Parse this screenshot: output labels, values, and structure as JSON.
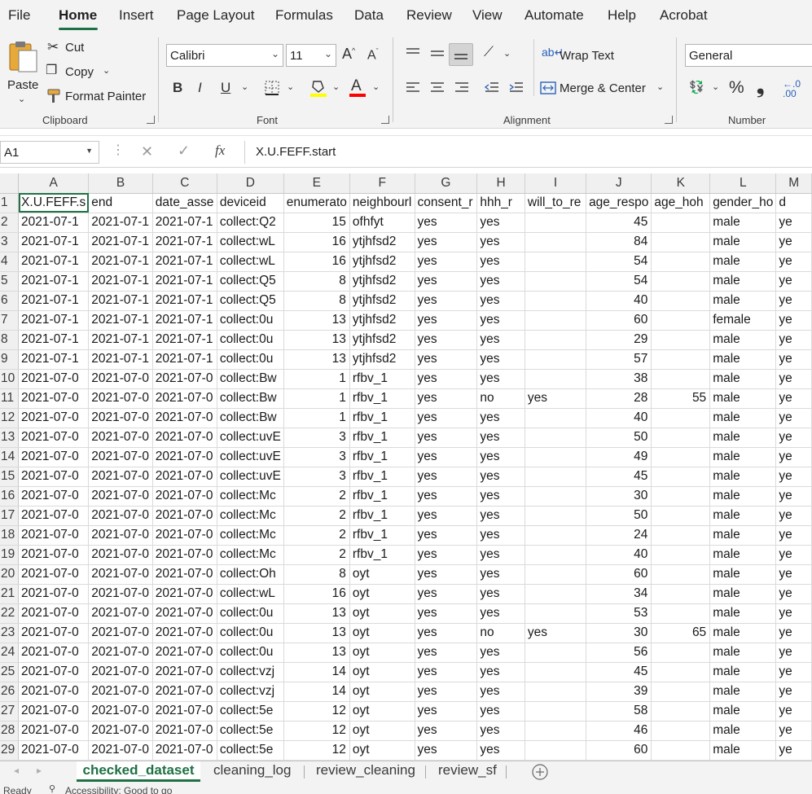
{
  "menu": {
    "tabs": [
      {
        "label": "File"
      },
      {
        "label": "Home"
      },
      {
        "label": "Insert"
      },
      {
        "label": "Page Layout"
      },
      {
        "label": "Formulas"
      },
      {
        "label": "Data"
      },
      {
        "label": "Review"
      },
      {
        "label": "View"
      },
      {
        "label": "Automate"
      },
      {
        "label": "Help"
      },
      {
        "label": "Acrobat"
      }
    ],
    "active": "Home"
  },
  "ribbon": {
    "clipboard": {
      "paste": "Paste",
      "cut": "Cut",
      "copy": "Copy",
      "format_painter": "Format Painter",
      "group": "Clipboard"
    },
    "font": {
      "name": "Calibri",
      "size": "11",
      "group": "Font",
      "highlight_color": "#ffff00",
      "font_color": "#ff0000"
    },
    "alignment": {
      "wrap_text": "Wrap Text",
      "merge_center": "Merge & Center",
      "group": "Alignment"
    },
    "number": {
      "format": "General",
      "group": "Number"
    }
  },
  "formula_bar": {
    "cell_ref": "A1",
    "fx": "fx",
    "content": "X.U.FEFF.start"
  },
  "grid": {
    "columns": [
      "A",
      "B",
      "C",
      "D",
      "E",
      "F",
      "G",
      "H",
      "I",
      "J",
      "K",
      "L",
      "M"
    ],
    "header_row": [
      "X.U.FEFF.s",
      "end",
      "date_asse",
      "deviceid",
      "enumerato",
      "neighbourl",
      "consent_r",
      "hhh_r",
      "will_to_re",
      "age_respo",
      "age_hoh",
      "gender_ho",
      "d"
    ],
    "rows": [
      [
        "2021-07-1",
        "2021-07-1",
        "2021-07-1",
        "collect:Q2",
        "15",
        "ofhfyt",
        "yes",
        "yes",
        "",
        "45",
        "",
        "male",
        "ye"
      ],
      [
        "2021-07-1",
        "2021-07-1",
        "2021-07-1",
        "collect:wL",
        "16",
        "ytjhfsd2",
        "yes",
        "yes",
        "",
        "84",
        "",
        "male",
        "ye"
      ],
      [
        "2021-07-1",
        "2021-07-1",
        "2021-07-1",
        "collect:wL",
        "16",
        "ytjhfsd2",
        "yes",
        "yes",
        "",
        "54",
        "",
        "male",
        "ye"
      ],
      [
        "2021-07-1",
        "2021-07-1",
        "2021-07-1",
        "collect:Q5",
        "8",
        "ytjhfsd2",
        "yes",
        "yes",
        "",
        "54",
        "",
        "male",
        "ye"
      ],
      [
        "2021-07-1",
        "2021-07-1",
        "2021-07-1",
        "collect:Q5",
        "8",
        "ytjhfsd2",
        "yes",
        "yes",
        "",
        "40",
        "",
        "male",
        "ye"
      ],
      [
        "2021-07-1",
        "2021-07-1",
        "2021-07-1",
        "collect:0u",
        "13",
        "ytjhfsd2",
        "yes",
        "yes",
        "",
        "60",
        "",
        "female",
        "ye"
      ],
      [
        "2021-07-1",
        "2021-07-1",
        "2021-07-1",
        "collect:0u",
        "13",
        "ytjhfsd2",
        "yes",
        "yes",
        "",
        "29",
        "",
        "male",
        "ye"
      ],
      [
        "2021-07-1",
        "2021-07-1",
        "2021-07-1",
        "collect:0u",
        "13",
        "ytjhfsd2",
        "yes",
        "yes",
        "",
        "57",
        "",
        "male",
        "ye"
      ],
      [
        "2021-07-0",
        "2021-07-0",
        "2021-07-0",
        "collect:Bw",
        "1",
        "rfbv_1",
        "yes",
        "yes",
        "",
        "38",
        "",
        "male",
        "ye"
      ],
      [
        "2021-07-0",
        "2021-07-0",
        "2021-07-0",
        "collect:Bw",
        "1",
        "rfbv_1",
        "yes",
        "no",
        "yes",
        "28",
        "55",
        "male",
        "ye"
      ],
      [
        "2021-07-0",
        "2021-07-0",
        "2021-07-0",
        "collect:Bw",
        "1",
        "rfbv_1",
        "yes",
        "yes",
        "",
        "40",
        "",
        "male",
        "ye"
      ],
      [
        "2021-07-0",
        "2021-07-0",
        "2021-07-0",
        "collect:uvE",
        "3",
        "rfbv_1",
        "yes",
        "yes",
        "",
        "50",
        "",
        "male",
        "ye"
      ],
      [
        "2021-07-0",
        "2021-07-0",
        "2021-07-0",
        "collect:uvE",
        "3",
        "rfbv_1",
        "yes",
        "yes",
        "",
        "49",
        "",
        "male",
        "ye"
      ],
      [
        "2021-07-0",
        "2021-07-0",
        "2021-07-0",
        "collect:uvE",
        "3",
        "rfbv_1",
        "yes",
        "yes",
        "",
        "45",
        "",
        "male",
        "ye"
      ],
      [
        "2021-07-0",
        "2021-07-0",
        "2021-07-0",
        "collect:Mc",
        "2",
        "rfbv_1",
        "yes",
        "yes",
        "",
        "30",
        "",
        "male",
        "ye"
      ],
      [
        "2021-07-0",
        "2021-07-0",
        "2021-07-0",
        "collect:Mc",
        "2",
        "rfbv_1",
        "yes",
        "yes",
        "",
        "50",
        "",
        "male",
        "ye"
      ],
      [
        "2021-07-0",
        "2021-07-0",
        "2021-07-0",
        "collect:Mc",
        "2",
        "rfbv_1",
        "yes",
        "yes",
        "",
        "24",
        "",
        "male",
        "ye"
      ],
      [
        "2021-07-0",
        "2021-07-0",
        "2021-07-0",
        "collect:Mc",
        "2",
        "rfbv_1",
        "yes",
        "yes",
        "",
        "40",
        "",
        "male",
        "ye"
      ],
      [
        "2021-07-0",
        "2021-07-0",
        "2021-07-0",
        "collect:Oh",
        "8",
        "oyt",
        "yes",
        "yes",
        "",
        "60",
        "",
        "male",
        "ye"
      ],
      [
        "2021-07-0",
        "2021-07-0",
        "2021-07-0",
        "collect:wL",
        "16",
        "oyt",
        "yes",
        "yes",
        "",
        "34",
        "",
        "male",
        "ye"
      ],
      [
        "2021-07-0",
        "2021-07-0",
        "2021-07-0",
        "collect:0u",
        "13",
        "oyt",
        "yes",
        "yes",
        "",
        "53",
        "",
        "male",
        "ye"
      ],
      [
        "2021-07-0",
        "2021-07-0",
        "2021-07-0",
        "collect:0u",
        "13",
        "oyt",
        "yes",
        "no",
        "yes",
        "30",
        "65",
        "male",
        "ye"
      ],
      [
        "2021-07-0",
        "2021-07-0",
        "2021-07-0",
        "collect:0u",
        "13",
        "oyt",
        "yes",
        "yes",
        "",
        "56",
        "",
        "male",
        "ye"
      ],
      [
        "2021-07-0",
        "2021-07-0",
        "2021-07-0",
        "collect:vzj",
        "14",
        "oyt",
        "yes",
        "yes",
        "",
        "45",
        "",
        "male",
        "ye"
      ],
      [
        "2021-07-0",
        "2021-07-0",
        "2021-07-0",
        "collect:vzj",
        "14",
        "oyt",
        "yes",
        "yes",
        "",
        "39",
        "",
        "male",
        "ye"
      ],
      [
        "2021-07-0",
        "2021-07-0",
        "2021-07-0",
        "collect:5e",
        "12",
        "oyt",
        "yes",
        "yes",
        "",
        "58",
        "",
        "male",
        "ye"
      ],
      [
        "2021-07-0",
        "2021-07-0",
        "2021-07-0",
        "collect:5e",
        "12",
        "oyt",
        "yes",
        "yes",
        "",
        "46",
        "",
        "male",
        "ye"
      ],
      [
        "2021-07-0",
        "2021-07-0",
        "2021-07-0",
        "collect:5e",
        "12",
        "oyt",
        "yes",
        "yes",
        "",
        "60",
        "",
        "male",
        "ye"
      ]
    ]
  },
  "sheets": {
    "tabs": [
      {
        "label": "checked_dataset"
      },
      {
        "label": "cleaning_log"
      },
      {
        "label": "review_cleaning"
      },
      {
        "label": "review_sf"
      }
    ],
    "active": "checked_dataset"
  },
  "status": {
    "ready": "Ready",
    "accessibility": "Accessibility: Good to go"
  },
  "colors": {
    "accent": "#1e7145",
    "ribbon_bg": "#f3f3f3"
  }
}
